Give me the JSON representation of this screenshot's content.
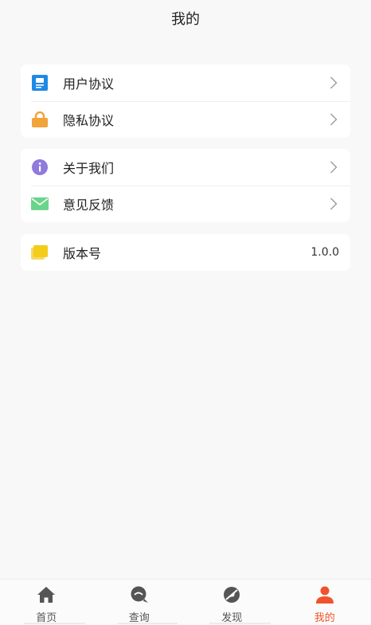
{
  "header": {
    "title": "我的"
  },
  "groups": [
    {
      "items": [
        {
          "label": "用户协议",
          "icon": "document-icon",
          "color": "#1e8ae6"
        },
        {
          "label": "隐私协议",
          "icon": "lock-icon",
          "color": "#f0a43a"
        }
      ]
    },
    {
      "items": [
        {
          "label": "关于我们",
          "icon": "info-icon",
          "color": "#8e7bdc"
        },
        {
          "label": "意见反馈",
          "icon": "mail-icon",
          "color": "#6bd48b"
        }
      ]
    },
    {
      "items": [
        {
          "label": "版本号",
          "icon": "version-icon",
          "color": "#f4cc1a",
          "value": "1.0.0"
        }
      ]
    }
  ],
  "tabbar": {
    "tabs": [
      {
        "label": "首页",
        "icon": "home-icon"
      },
      {
        "label": "查询",
        "icon": "chat-search-icon"
      },
      {
        "label": "发现",
        "icon": "compass-icon"
      },
      {
        "label": "我的",
        "icon": "user-icon",
        "active": true
      }
    ],
    "active_color": "#f0532b",
    "inactive_color": "#555555"
  }
}
